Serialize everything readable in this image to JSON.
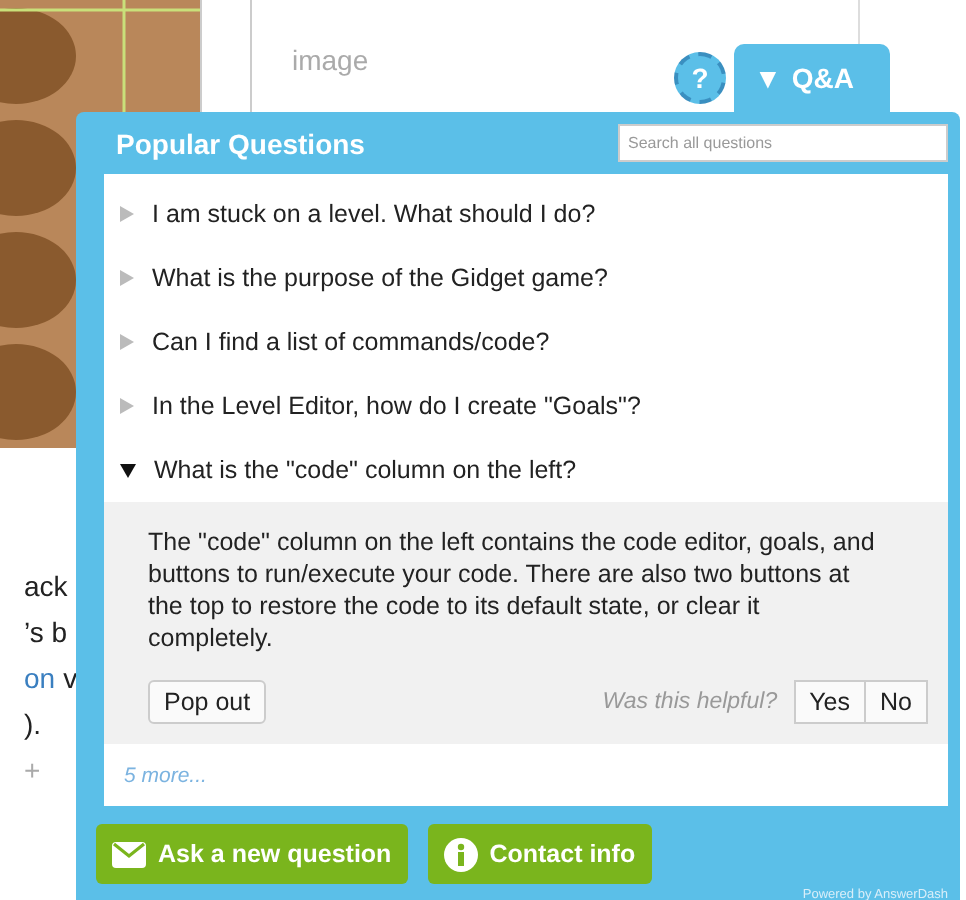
{
  "background": {
    "list_items": [
      "image"
    ],
    "snippets": [
      {
        "kind": "text",
        "text": "ack"
      },
      {
        "kind": "text",
        "text": "’s b"
      },
      {
        "kind": "link",
        "text": "on",
        "after": "v"
      },
      {
        "kind": "text",
        "text": ")."
      },
      {
        "kind": "muted",
        "text": "+"
      }
    ]
  },
  "help_icon": "?",
  "tab": {
    "arrow": "▼",
    "label": "Q&A"
  },
  "panel": {
    "title": "Popular Questions",
    "search": {
      "placeholder": "Search all questions"
    },
    "questions": [
      {
        "text": "I am stuck on a level. What should I do?",
        "expanded": false
      },
      {
        "text": "What is the purpose of the Gidget game?",
        "expanded": false
      },
      {
        "text": "Can I find a list of commands/code?",
        "expanded": false
      },
      {
        "text": "In the Level Editor, how do I create \"Goals\"?",
        "expanded": false
      },
      {
        "text": "What is the \"code\" column on the left?",
        "expanded": true,
        "answer": "The \"code\" column on the left contains the code editor, goals, and buttons to run/execute your code. There are also two buttons at the top to restore the code to its default state, or clear it completely."
      }
    ],
    "pop_out": "Pop out",
    "helpful": "Was this helpful?",
    "yes": "Yes",
    "no": "No",
    "more": "5 more...",
    "actions": [
      {
        "kind": "mail",
        "label": "Ask a new question"
      },
      {
        "kind": "info",
        "label": "Contact info"
      }
    ],
    "powered_by": "Powered by AnswerDash"
  }
}
